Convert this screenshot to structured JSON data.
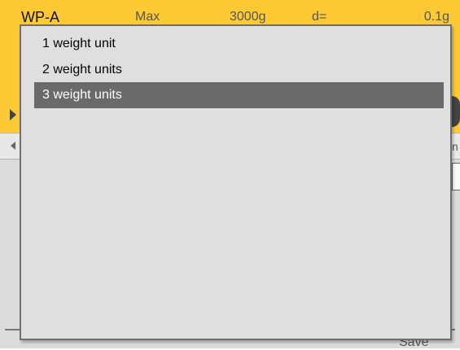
{
  "header": {
    "model": "WP-A",
    "max_label": "Max",
    "capacity": "3000g",
    "d_label": "d=",
    "resolution": "0.1g"
  },
  "nav": {
    "peek_text": "n"
  },
  "footer": {
    "save_label": "Save"
  },
  "dropdown": {
    "options": [
      {
        "label": "1 weight unit"
      },
      {
        "label": "2 weight units"
      },
      {
        "label": "3 weight units"
      }
    ],
    "selected_index": 2
  },
  "colors": {
    "header_bg": "#fdc934",
    "selected_bg": "#6a6a6a",
    "list_bg": "#dfdfdf"
  }
}
